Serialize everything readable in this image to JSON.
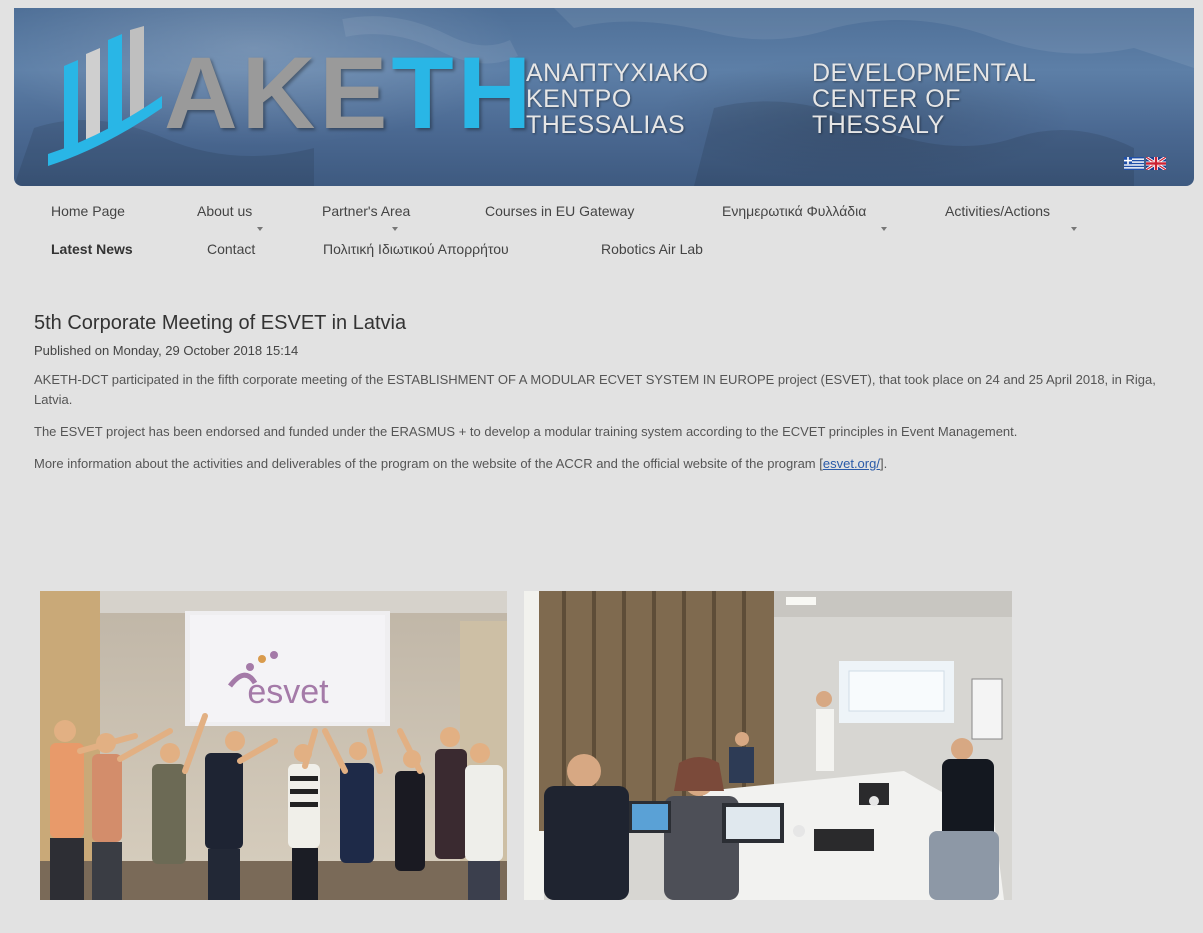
{
  "header": {
    "logo_letters_gray": "AKE",
    "logo_letters_blue": "TH",
    "tagline_gr": [
      "ΑΝΑΠΤΥΧΙΑΚΟ",
      "ΚΕΝΤΡΟ",
      "THESSALIAS"
    ],
    "tagline_en": [
      "DEVELOPMENTAL",
      "CENTER OF",
      "THESSALY"
    ],
    "flags": [
      "greek-flag-icon",
      "uk-flag-icon"
    ],
    "colors": {
      "banner": "#4e6f97",
      "logo_gray": "#9a9a9a",
      "logo_blue": "#29b6e6"
    }
  },
  "nav": {
    "row1": [
      "Home Page",
      "About us",
      "Partner's Area",
      "Courses in EU Gateway",
      "Ενημερωτικά Φυλλάδια",
      "Activities/Actions"
    ],
    "row2": [
      "Latest News",
      "Contact",
      "Πολιτική Ιδιωτικού Απορρήτου",
      "Robotics Air Lab"
    ]
  },
  "article": {
    "title": "5th Corporate Meeting of ESVET in Latvia",
    "published": "Published on Monday, 29 October 2018 15:14",
    "paragraph1": "AKETH-DCT participated in the fifth corporate meeting of the ESTABLISHMENT OF A MODULAR ECVET SYSTEM IN EUROPE project (ESVET), that took place on 24 and 25 April 2018, in Riga, Latvia.",
    "paragraph2": "The ESVET project has been endorsed and funded under the ERASMUS + to develop a modular training system according to the ECVET principles in Event Management.",
    "paragraph3_text": "More information about the activities and deliverables of the program on the website of the ACCR and the official website of the program [",
    "paragraph3_link": "esvet.org/",
    "paragraph3_end": "]."
  },
  "photos": {
    "photo1_screen_text": "esvet"
  }
}
